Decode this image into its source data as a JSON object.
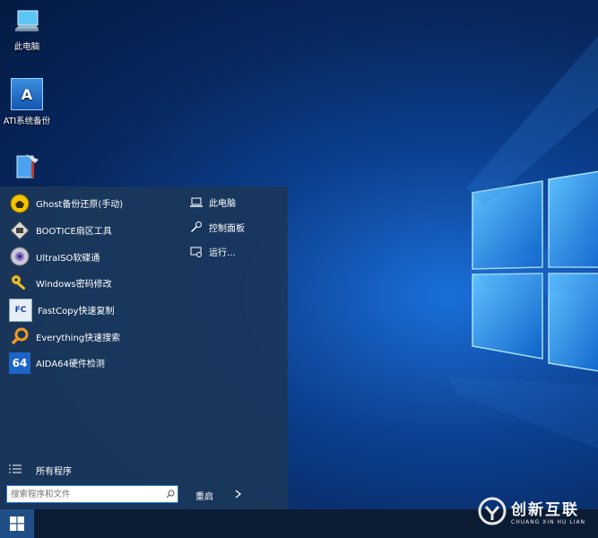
{
  "desktop": {
    "icons": [
      {
        "label": "此电脑",
        "icon": "computer-icon"
      },
      {
        "label": "ATI系统备份",
        "icon": "ati-backup-icon"
      },
      {
        "label": "",
        "icon": "tool-icon"
      }
    ]
  },
  "start_menu": {
    "apps": [
      {
        "label": "Ghost备份还原(手动)",
        "icon": "ghost-icon"
      },
      {
        "label": "BOOTICE扇区工具",
        "icon": "bootice-icon"
      },
      {
        "label": "UltraISO软碟通",
        "icon": "disc-icon"
      },
      {
        "label": "Windows密码修改",
        "icon": "key-icon"
      },
      {
        "label": "FastCopy快速复制",
        "icon": "fastcopy-icon"
      },
      {
        "label": "Everything快速搜索",
        "icon": "magnifier-icon"
      },
      {
        "label": "AIDA64硬件检测",
        "icon": "aida64-icon"
      }
    ],
    "right_items": [
      {
        "label": "此电脑",
        "icon": "laptop-icon"
      },
      {
        "label": "控制面板",
        "icon": "wrench-icon"
      },
      {
        "label": "运行...",
        "icon": "run-icon"
      }
    ],
    "all_programs": "所有程序",
    "search": {
      "placeholder": "搜索程序和文件"
    },
    "restart": "重启",
    "fastcopy_badge": "FC",
    "aida_badge": "64",
    "ati_badge": "A"
  },
  "watermark": {
    "cn": "创新互联",
    "en": "CHUANG XIN HU LIAN"
  },
  "colors": {
    "menu_bg": "#1b375a",
    "taskbar": "#0b1d35",
    "accent": "#2a7fd8"
  }
}
